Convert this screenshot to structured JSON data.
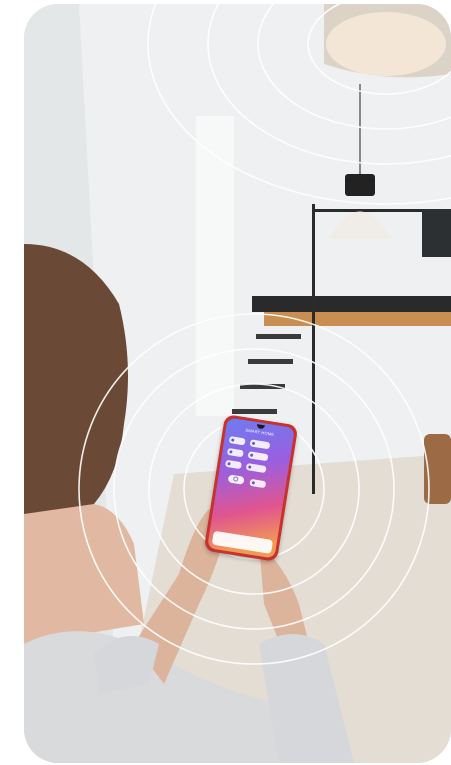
{
  "phone": {
    "app_title": "SMART HOME"
  },
  "icons": [
    "lamp-icon",
    "thermometer-icon",
    "power-icon",
    "plug-icon",
    "lock-icon"
  ],
  "colors": {
    "phone_case": "#c8322c",
    "screen_gradient_start": "#6c7cf0",
    "screen_gradient_end": "#f29a55",
    "signal_rings": "#ffffff",
    "wall": "#eceeef",
    "floor": "#e2dcd3"
  }
}
